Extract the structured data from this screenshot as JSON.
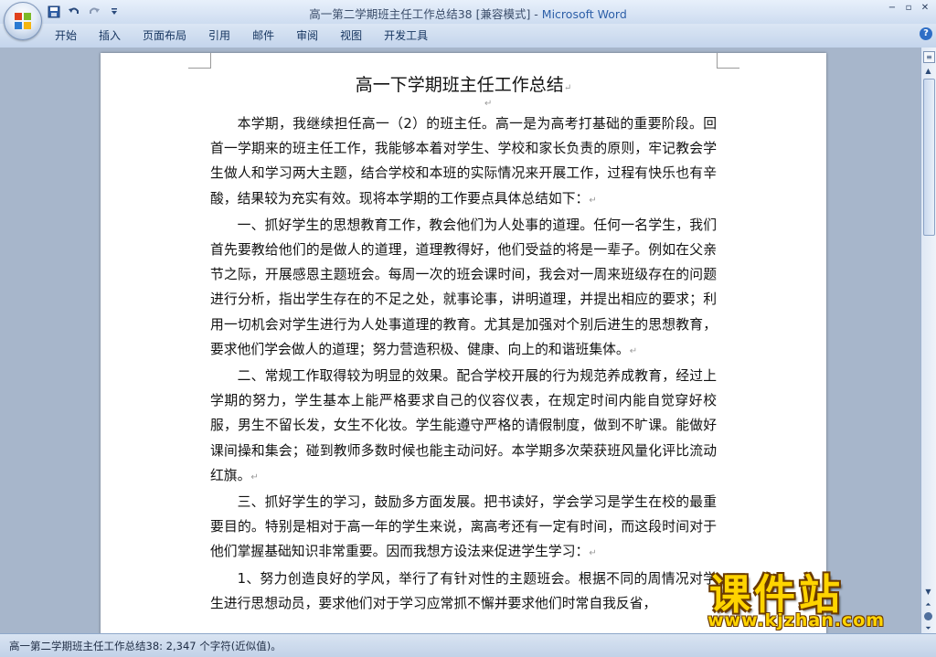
{
  "window": {
    "title_doc": "高一第二学期班主任工作总结38 [兼容模式] - ",
    "title_app": "Microsoft Word",
    "controls": [
      "−",
      "▫",
      "✕"
    ]
  },
  "quick_access": {
    "save_icon": "floppy-disk-icon",
    "undo_icon": "undo-icon",
    "redo_icon": "redo-icon",
    "customize_icon": "dropdown-arrow-icon"
  },
  "ribbon": {
    "tabs": [
      "开始",
      "插入",
      "页面布局",
      "引用",
      "邮件",
      "审阅",
      "视图",
      "开发工具"
    ],
    "help": "?"
  },
  "document": {
    "title": "高一下学期班主任工作总结",
    "paragraph_mark": "↵",
    "paragraphs": [
      "本学期，我继续担任高一（2）的班主任。高一是为高考打基础的重要阶段。回首一学期来的班主任工作，我能够本着对学生、学校和家长负责的原则，牢记教会学生做人和学习两大主题，结合学校和本班的实际情况来开展工作，过程有快乐也有辛酸，结果较为充实有效。现将本学期的工作要点具体总结如下：",
      "一、抓好学生的思想教育工作，教会他们为人处事的道理。任何一名学生，我们首先要教给他们的是做人的道理，道理教得好，他们受益的将是一辈子。例如在父亲节之际，开展感恩主题班会。每周一次的班会课时间，我会对一周来班级存在的问题进行分析，指出学生存在的不足之处，就事论事，讲明道理，并提出相应的要求；利用一切机会对学生进行为人处事道理的教育。尤其是加强对个别后进生的思想教育，要求他们学会做人的道理；努力营造积极、健康、向上的和谐班集体。",
      "二、常规工作取得较为明显的效果。配合学校开展的行为规范养成教育，经过上学期的努力，学生基本上能严格要求自己的仪容仪表，在规定时间内能自觉穿好校服，男生不留长发，女生不化妆。学生能遵守严格的请假制度，做到不旷课。能做好课间操和集会；碰到教师多数时候也能主动问好。本学期多次荣获班风量化评比流动红旗。",
      "三、抓好学生的学习，鼓励多方面发展。把书读好，学会学习是学生在校的最重要目的。特别是相对于高一年的学生来说，离高考还有一定有时间，而这段时间对于他们掌握基础知识非常重要。因而我想方设法来促进学生学习：",
      "1、努力创造良好的学风，举行了有针对性的主题班会。根据不同的周情况对学生进行思想动员，要求他们对于学习应常抓不懈并要求他们时常自我反省，"
    ]
  },
  "status": {
    "text": "高一第二学期班主任工作总结38: 2,347 个字符(近似值)。"
  },
  "watermark": {
    "cn": "课件站",
    "url": "www.kjzhan.com"
  },
  "colors": {
    "accent": "#2d5fa8",
    "watermark": "#ffd400"
  }
}
